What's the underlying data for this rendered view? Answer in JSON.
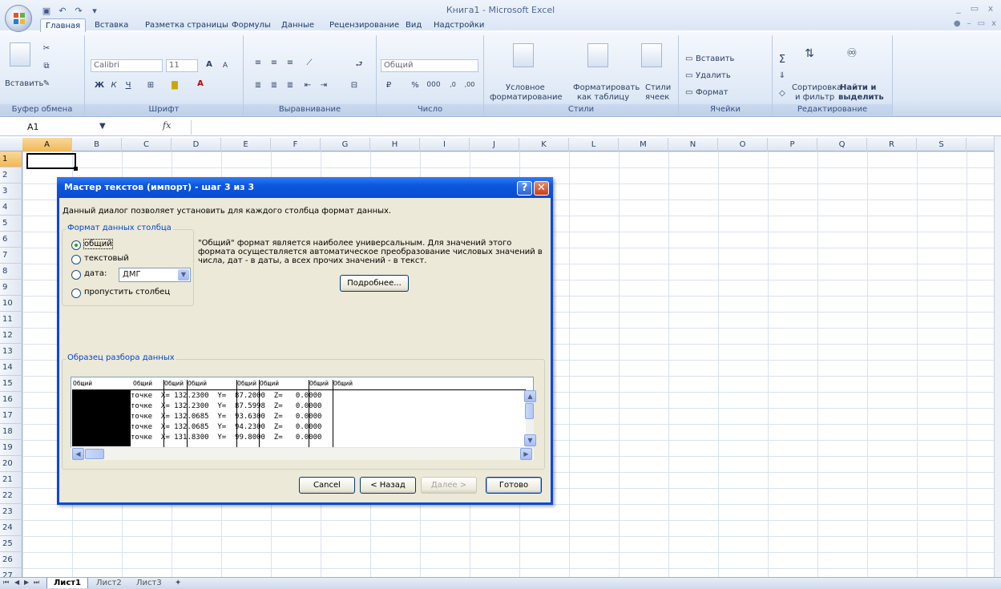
{
  "window": {
    "title": "Книга1 - Microsoft Excel",
    "controls": [
      "_",
      "▭",
      "x"
    ]
  },
  "qat_icons": [
    "save-icon",
    "undo-icon",
    "redo-icon",
    "customize-icon"
  ],
  "tabs": [
    {
      "label": "Главная",
      "active": true
    },
    {
      "label": "Вставка"
    },
    {
      "label": "Разметка страницы"
    },
    {
      "label": "Формулы"
    },
    {
      "label": "Данные"
    },
    {
      "label": "Рецензирование"
    },
    {
      "label": "Вид"
    },
    {
      "label": "Надстройки"
    }
  ],
  "ribbon": {
    "clipboard": {
      "paste": "Вставить",
      "label": "Буфер обмена"
    },
    "font": {
      "name": "Calibri",
      "size": "11",
      "bold": "Ж",
      "italic": "К",
      "underline": "Ч",
      "grow": "A",
      "shrink": "A",
      "label": "Шрифт"
    },
    "alignment": {
      "label": "Выравнивание"
    },
    "number": {
      "format": "Общий",
      "percent": "%",
      "thousands": "000",
      "inc": ",0",
      "dec": ",00",
      "label": "Число"
    },
    "styles": {
      "conditional": "Условное",
      "conditional2": "форматирование",
      "astable": "Форматировать",
      "astable2": "как таблицу",
      "cellstyles": "Стили",
      "cellstyles2": "ячеек",
      "label": "Стили"
    },
    "cells": {
      "insert": "Вставить",
      "delete": "Удалить",
      "format": "Формат",
      "label": "Ячейки"
    },
    "editing": {
      "sort": "Сортировка",
      "sort2": "и фильтр",
      "find": "Найти и",
      "find2": "выделить",
      "label": "Редактирование"
    }
  },
  "formula_bar": {
    "name_box": "A1",
    "fx": "fx",
    "value": ""
  },
  "columns": [
    "A",
    "B",
    "C",
    "D",
    "E",
    "F",
    "G",
    "H",
    "I",
    "J",
    "K",
    "L",
    "M",
    "N",
    "O",
    "P",
    "Q",
    "R",
    "S"
  ],
  "rows": [
    "1",
    "2",
    "3",
    "4",
    "5",
    "6",
    "7",
    "8",
    "9",
    "10",
    "11",
    "12",
    "13",
    "14",
    "15",
    "16",
    "17",
    "18",
    "19",
    "20",
    "21",
    "22",
    "23",
    "24",
    "25",
    "26",
    "27"
  ],
  "sheets": {
    "tabs": [
      "Лист1",
      "Лист2",
      "Лист3"
    ],
    "active": "Лист1"
  },
  "dialog": {
    "title": "Мастер текстов (импорт) - шаг 3 из 3",
    "description": "Данный диалог позволяет установить для каждого столбца формат данных.",
    "column_format_legend": "Формат данных столбца",
    "radio_general": "общий",
    "radio_text": "текстовый",
    "radio_date": "дата:",
    "date_value": "ДМГ",
    "radio_skip": "пропустить столбец",
    "info": "\"Общий\" формат является наиболее универсальным. Для значений этого формата осуществляется автоматическое преобразование числовых значений в числа, дат - в даты, а всех прочих значений - в текст.",
    "more_button": "Подробнее...",
    "sample_legend": "Образец разбора данных",
    "preview_headers": [
      "Общий",
      "Общий",
      "Общий",
      "Общий",
      "Общий",
      "Общий",
      "Общий",
      "Общий"
    ],
    "preview_rows": [
      "точке  X= 132.2300  Y=  87.2000  Z=   0.0000",
      "точке  X= 132.2300  Y=  87.5998  Z=   0.0000",
      "точке  X= 132.0685  Y=  93.6300  Z=   0.0000",
      "точке  X= 132.0685  Y=  94.2300  Z=   0.0000",
      "точке  X= 131.8300  Y=  99.8000  Z=   0.0000"
    ],
    "cancel": "Cancel",
    "back": "< Назад",
    "next": "Далее >",
    "finish": "Готово"
  }
}
